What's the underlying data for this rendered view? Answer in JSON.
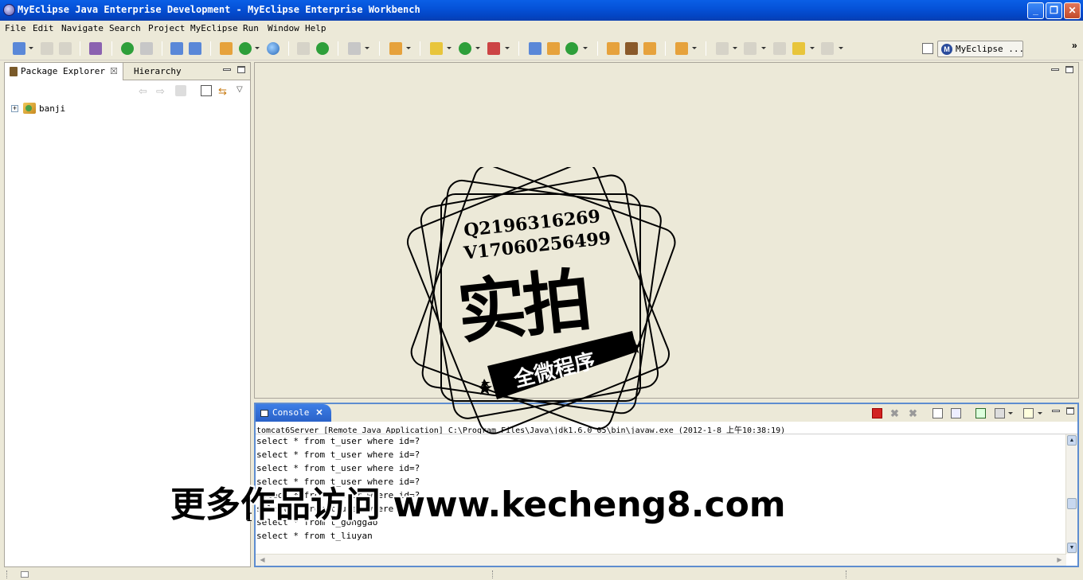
{
  "window": {
    "title": "MyEclipse Java Enterprise Development - MyEclipse Enterprise Workbench",
    "minimize": "_",
    "maximize": "❐",
    "close": "✕"
  },
  "menu": [
    "File",
    "Edit",
    "Navigate",
    "Search",
    "Project",
    "MyEclipse",
    "Run",
    "Window",
    "Help"
  ],
  "perspective": {
    "label": "MyEclipse ...",
    "icon_letter": "M",
    "chevron": "»"
  },
  "package_explorer": {
    "tabs": [
      {
        "label": "Package Explorer",
        "close": "☒"
      },
      {
        "label": "Hierarchy"
      }
    ],
    "tree": [
      {
        "expander": "+",
        "label": "banji",
        "icon": "project-icon"
      }
    ]
  },
  "console": {
    "tab_label": "Console",
    "tab_close": "✕",
    "header": "tomcat6Server [Remote Java Application] C:\\Program Files\\Java\\jdk1.6.0_05\\bin\\javaw.exe (2012-1-8 上午10:38:19)",
    "lines": [
      "select * from t_user where id=?",
      "select * from t_user where id=?",
      "select * from t_user where id=?",
      "select * from t_user where id=?",
      "select * from t_user where id=?",
      "select * from t_user where id=?",
      "select * from t_gonggao",
      "select * from t_liuyan"
    ],
    "colors": {
      "tab": "#2a62c8",
      "border": "#5e8dd0",
      "terminate": "#d22222"
    }
  },
  "watermark": {
    "stamp": {
      "line1": "Q2196316269",
      "line2": "V17060256499",
      "big": "实拍",
      "ribbon": "全微程序"
    },
    "caption": "更多作品访问 www.kecheng8.com"
  }
}
